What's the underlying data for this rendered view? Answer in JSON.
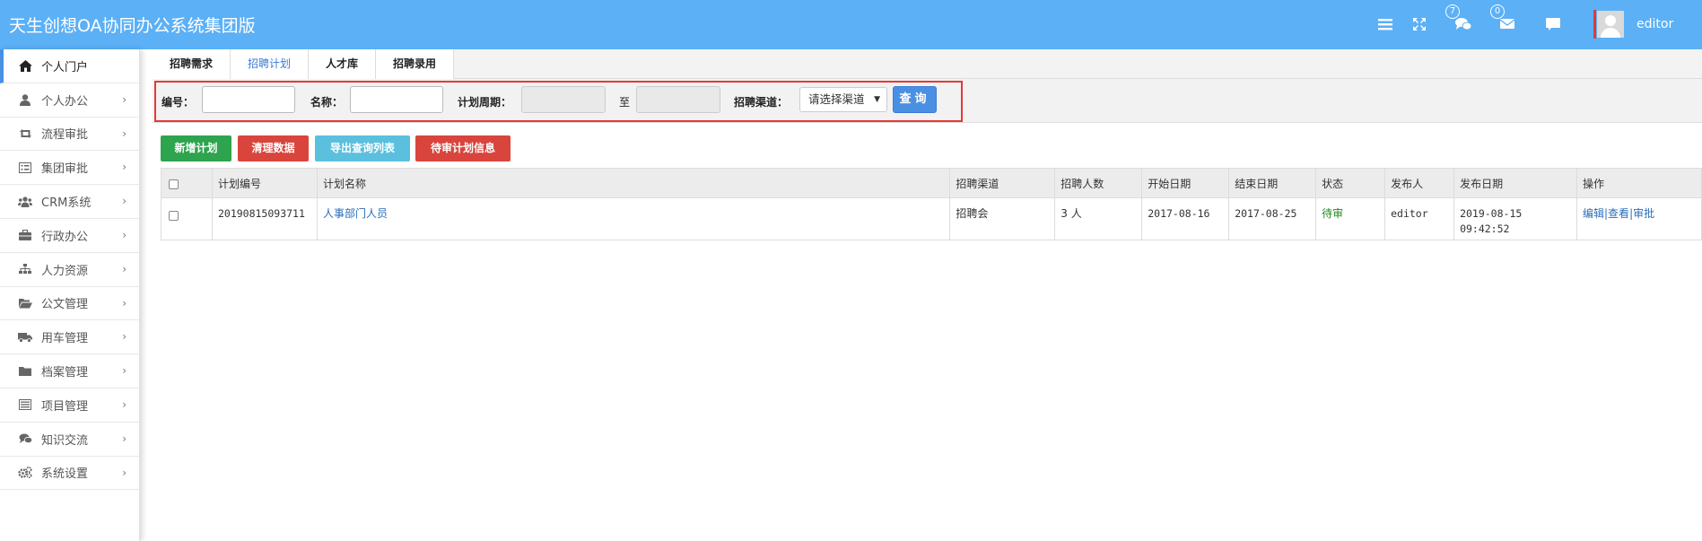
{
  "app": {
    "title": "天生创想OA协同办公系统集团版"
  },
  "topbar": {
    "chat_badge": "7",
    "mail_badge": "0",
    "user_name": "editor"
  },
  "sidebar": {
    "items": [
      {
        "label": "个人门户",
        "icon": "home-icon"
      },
      {
        "label": "个人办公",
        "icon": "user-icon"
      },
      {
        "label": "流程审批",
        "icon": "retweet-icon"
      },
      {
        "label": "集团审批",
        "icon": "list-alt-icon"
      },
      {
        "label": "CRM系统",
        "icon": "group-icon"
      },
      {
        "label": "行政办公",
        "icon": "briefcase-icon"
      },
      {
        "label": "人力资源",
        "icon": "sitemap-icon"
      },
      {
        "label": "公文管理",
        "icon": "folder-open-icon"
      },
      {
        "label": "用车管理",
        "icon": "truck-icon"
      },
      {
        "label": "档案管理",
        "icon": "folder-icon"
      },
      {
        "label": "项目管理",
        "icon": "list-icon"
      },
      {
        "label": "知识交流",
        "icon": "comments-icon"
      },
      {
        "label": "系统设置",
        "icon": "cogs-icon"
      }
    ]
  },
  "tabs": [
    "招聘需求",
    "招聘计划",
    "人才库",
    "招聘录用"
  ],
  "filter": {
    "code_label": "编号：",
    "name_label": "名称：",
    "period_label": "计划周期：",
    "to_label": "至",
    "channel_label": "招聘渠道：",
    "channel_value": "请选择渠道",
    "query_label": "查询"
  },
  "actions": {
    "add_label": "新增计划",
    "clear_label": "清理数据",
    "export_label": "导出查询列表",
    "pending_label": "待审计划信息"
  },
  "table": {
    "headers": [
      "计划编号",
      "计划名称",
      "招聘渠道",
      "招聘人数",
      "开始日期",
      "结束日期",
      "状态",
      "发布人",
      "发布日期",
      "操作"
    ],
    "rows": [
      {
        "code": "20190815093711",
        "name": "人事部门人员",
        "channel": "招聘会",
        "count": "3 人",
        "start": "2017-08-16",
        "end": "2017-08-25",
        "status": "待审",
        "publisher": "editor",
        "publish_date": "2019-08-15",
        "publish_time": "09:42:52",
        "op_edit": "编辑",
        "op_sep": "|",
        "op_view": "查看",
        "op_approve": "审批"
      }
    ]
  },
  "colors": {
    "topbar": "#5bb0f6",
    "add_button": "#2ea44f",
    "clear_button": "#d9453d",
    "export_button": "#5bc0de",
    "pending_button": "#d9453d",
    "query_button": "#4a90e2",
    "highlight_border": "#e53935"
  }
}
